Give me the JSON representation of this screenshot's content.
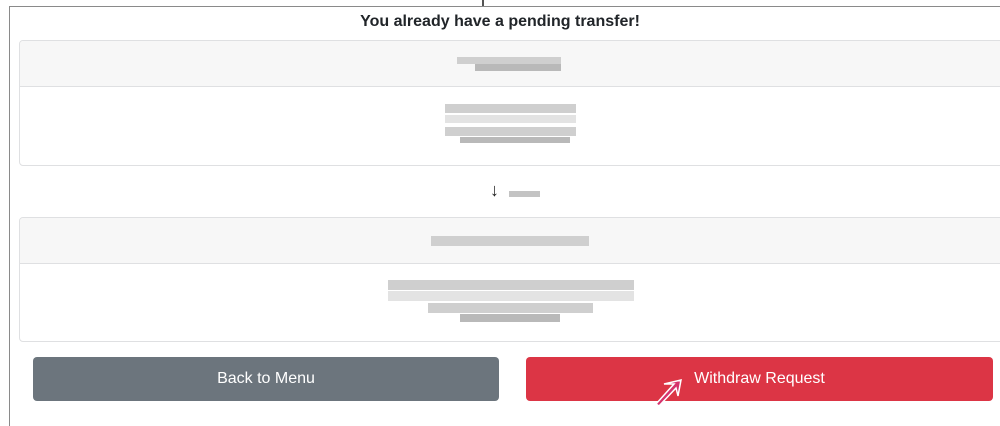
{
  "dialog": {
    "title": "You already have a pending transfer!"
  },
  "actions": {
    "back_label": "Back to Menu",
    "withdraw_label": "Withdraw Request"
  },
  "colors": {
    "secondary": "#6c757d",
    "danger": "#dc3545",
    "cursor": "#d6336c"
  },
  "icons": {
    "direction": "arrow-down-icon",
    "pointer": "mouse-cursor-icon"
  }
}
